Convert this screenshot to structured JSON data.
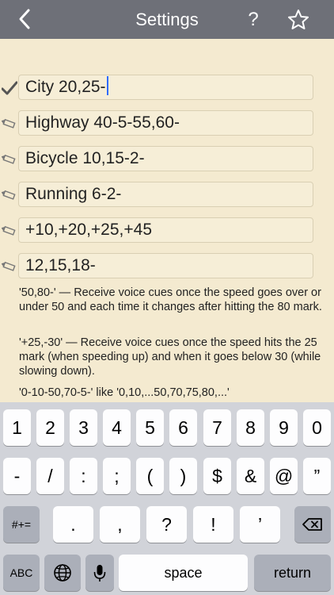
{
  "nav": {
    "title": "Settings",
    "back_icon": "chevron-left-icon",
    "help_label": "?",
    "star_icon": "star-icon"
  },
  "presets": [
    {
      "value": "City 20,25-",
      "selected": true,
      "icon": "checkmark-icon"
    },
    {
      "value": "Highway 40-5-55,60-",
      "selected": false,
      "icon": "pencil-icon"
    },
    {
      "value": "Bicycle 10,15-2-",
      "selected": false,
      "icon": "pencil-icon"
    },
    {
      "value": "Running 6-2-",
      "selected": false,
      "icon": "pencil-icon"
    },
    {
      "value": "+10,+20,+25,+45",
      "selected": false,
      "icon": "pencil-icon"
    },
    {
      "value": "12,15,18-",
      "selected": false,
      "icon": "pencil-icon"
    }
  ],
  "help": [
    "'50,80-' — Receive voice cues once the speed goes over or under 50 and each time it changes after hitting the 80 mark.",
    "'+25,-30' — Receive voice cues once the speed hits the 25 mark (when speeding up) and when it goes below 30 (while slowing down).",
    "'0-10-50,70-5-' like '0,10,...50,70,75,80,...'"
  ],
  "keyboard": {
    "row1": [
      "1",
      "2",
      "3",
      "4",
      "5",
      "6",
      "7",
      "8",
      "9",
      "0"
    ],
    "row2": [
      "-",
      "/",
      ":",
      ";",
      "(",
      ")",
      "$",
      "&",
      "@",
      "”"
    ],
    "row3_mode": "#+=",
    "row3": [
      ".",
      ",",
      "?",
      "!",
      "’"
    ],
    "backspace_icon": "backspace-icon",
    "abc": "ABC",
    "globe_icon": "globe-icon",
    "mic_icon": "microphone-icon",
    "space": "space",
    "return": "return"
  },
  "colors": {
    "background": "#f4ead0",
    "navbar": "#6e7078",
    "caret": "#2f6bff",
    "keyboard": "#d1d3d9"
  }
}
